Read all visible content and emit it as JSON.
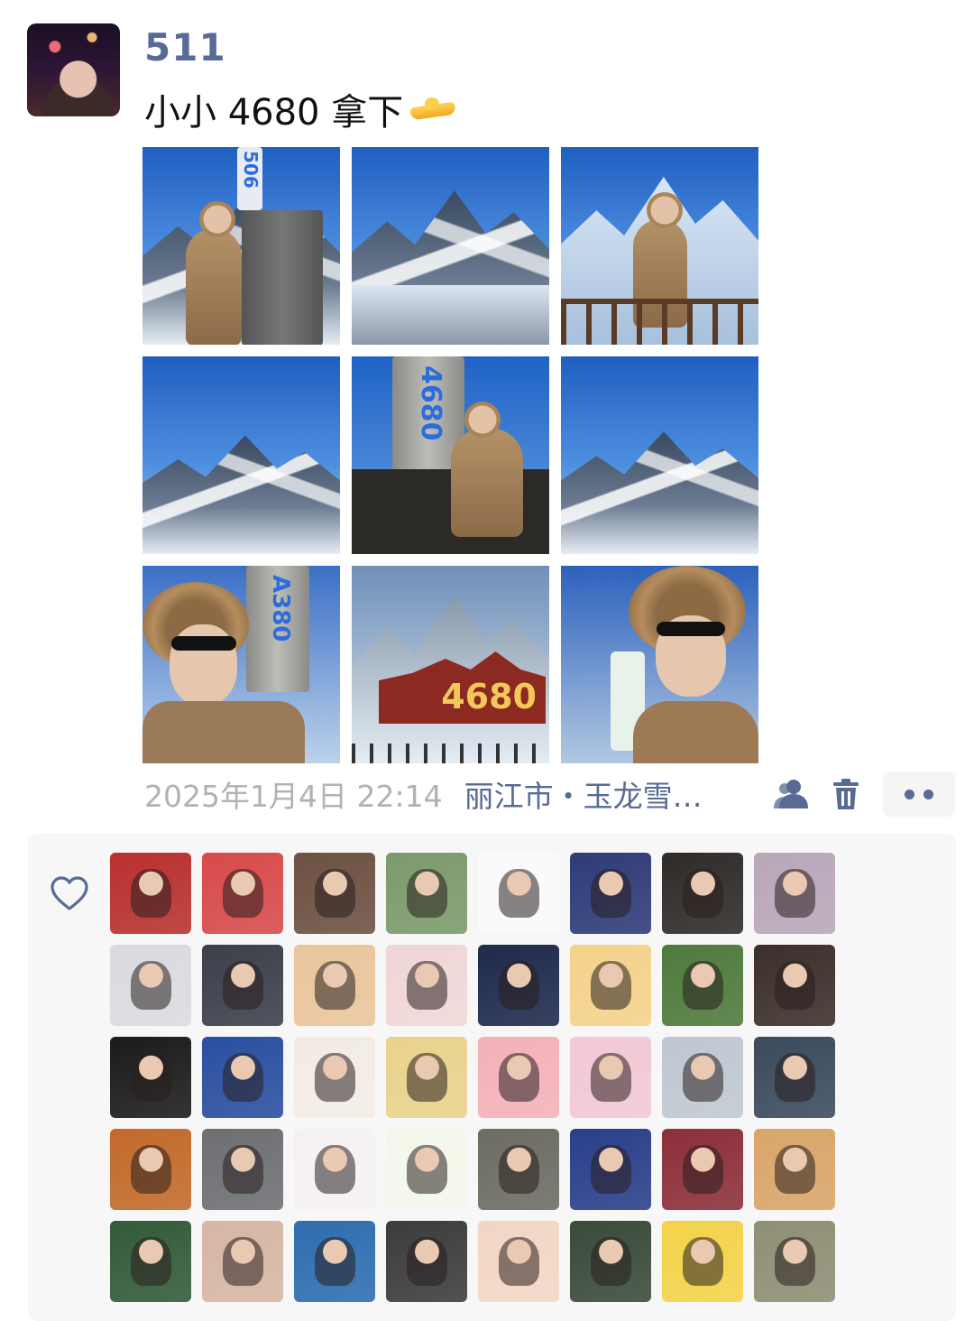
{
  "post": {
    "username": "511",
    "text": "小小 4680 拿下",
    "emoji_icon": "hands-holding-icon",
    "timestamp": "2025年1月4日 22:14",
    "location": "丽江市・玉龙雪…",
    "sign_text": "4680",
    "stone_texts": [
      "506",
      "4680",
      "A380"
    ],
    "photo_count": 9
  },
  "actions": {
    "friends_icon": "friend-icon",
    "delete_icon": "trash-icon",
    "more_icon": "more-dots-icon"
  },
  "likes": {
    "icon": "heart-icon",
    "avatar_count": 40,
    "colors": [
      "#b8312f",
      "#d84a4a",
      "#6d5142",
      "#7c9a6b",
      "#fafafa",
      "#2f3b78",
      "#2e2b29",
      "#b8a7b9",
      "#d9dbe0",
      "#3c3f4a",
      "#e9c59b",
      "#f0d6d6",
      "#1f2a4c",
      "#f4d28a",
      "#4f7a3c",
      "#3c2f2a",
      "#1b1b1b",
      "#2a4fa0",
      "#f2ece4",
      "#e9d28c",
      "#f4b1b8",
      "#f2c8d4",
      "#bfc8d2",
      "#3b4a5c",
      "#c26a2b",
      "#6d6f73",
      "#f6f1f1",
      "#f3f7ea",
      "#6c6c63",
      "#2a3f8a",
      "#8c2f3b",
      "#d9a56a",
      "#335a3a",
      "#d6b6a4",
      "#2e6db0",
      "#3c3c3c",
      "#f2d6c4",
      "#3a4b3a",
      "#f3d34a",
      "#8e8f74"
    ]
  }
}
